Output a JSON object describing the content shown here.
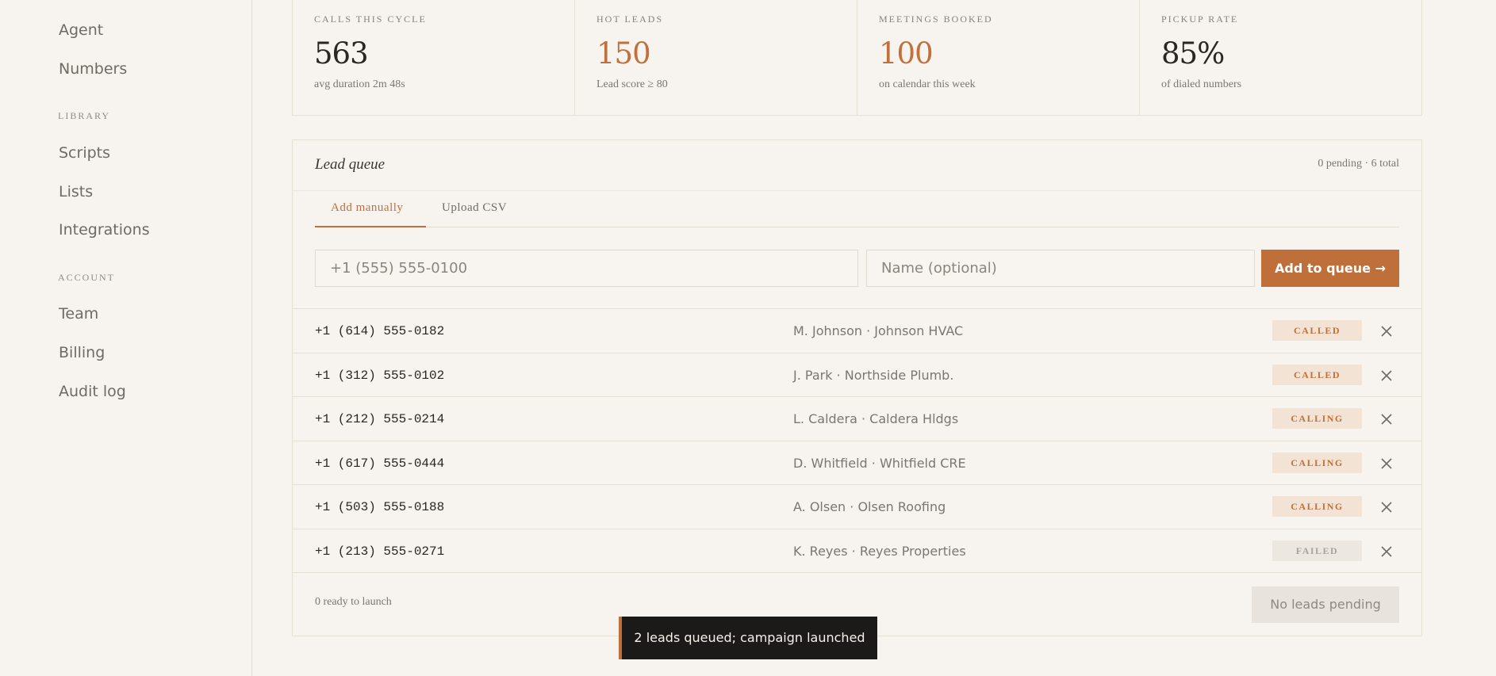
{
  "sidebar": {
    "top_items": [
      {
        "label": "Agent"
      },
      {
        "label": "Numbers"
      }
    ],
    "library": {
      "title": "LIBRARY",
      "items": [
        {
          "label": "Scripts"
        },
        {
          "label": "Lists"
        },
        {
          "label": "Integrations"
        }
      ]
    },
    "account": {
      "title": "ACCOUNT",
      "items": [
        {
          "label": "Team"
        },
        {
          "label": "Billing"
        },
        {
          "label": "Audit log"
        }
      ]
    }
  },
  "stats": [
    {
      "label": "CALLS THIS CYCLE",
      "value": "563",
      "sub": "avg duration 2m 48s"
    },
    {
      "label": "HOT LEADS",
      "value": "150",
      "sub": "Lead score ≥ 80"
    },
    {
      "label": "MEETINGS BOOKED",
      "value": "100",
      "sub": "on calendar this week"
    },
    {
      "label": "PICKUP RATE",
      "value": "85%",
      "sub": "of dialed numbers"
    }
  ],
  "colors": {
    "accent": "#c0703c",
    "background": "#f7f4ef",
    "toast_bg": "#1c1a18"
  },
  "lead_queue": {
    "title": "Lead queue",
    "count": "0 pending · 6 total",
    "tabs": [
      {
        "label": "Add manually"
      },
      {
        "label": "Upload CSV"
      }
    ],
    "phone_placeholder": "+1 (555) 555-0100",
    "name_placeholder": "Name (optional)",
    "add_label": "Add to queue →",
    "rows": [
      {
        "phone": "+1 (614) 555-0182",
        "name": "M. Johnson · Johnson HVAC",
        "status": "CALLED"
      },
      {
        "phone": "+1 (312) 555-0102",
        "name": "J. Park · Northside Plumb.",
        "status": "CALLED"
      },
      {
        "phone": "+1 (212) 555-0214",
        "name": "L. Caldera · Caldera Hldgs",
        "status": "CALLING"
      },
      {
        "phone": "+1 (617) 555-0444",
        "name": "D. Whitfield · Whitfield CRE",
        "status": "CALLING"
      },
      {
        "phone": "+1 (503) 555-0188",
        "name": "A. Olsen · Olsen Roofing",
        "status": "CALLING"
      },
      {
        "phone": "+1 (213) 555-0271",
        "name": "K. Reyes · Reyes Properties",
        "status": "FAILED"
      }
    ],
    "footer_text": "0 ready to launch",
    "pending_label": "No leads pending"
  },
  "toast": {
    "message": "2 leads queued; campaign launched"
  }
}
